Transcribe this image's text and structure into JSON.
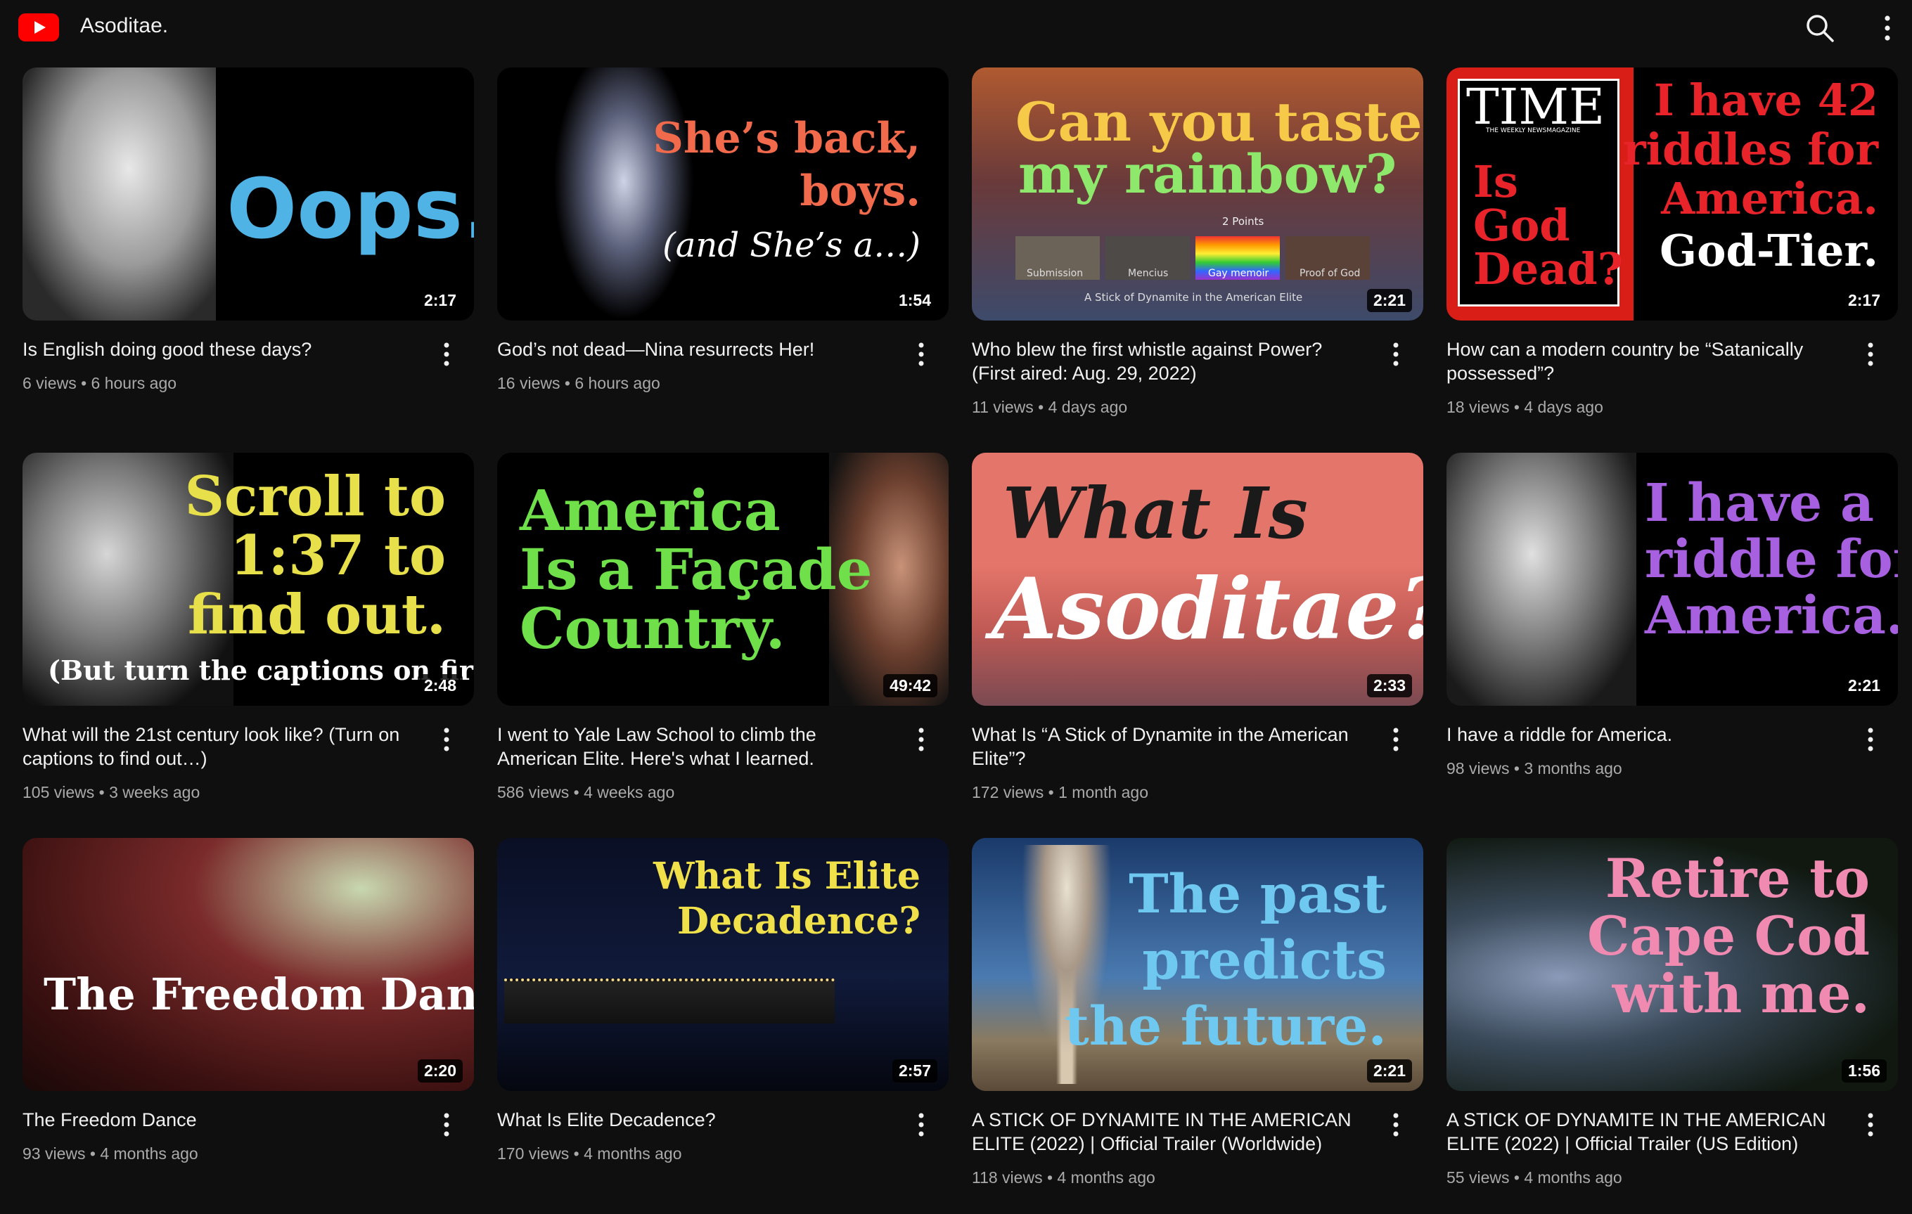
{
  "header": {
    "channel_title": "Asoditae.",
    "logo_icon": "youtube-logo-icon",
    "search_icon": "search-icon",
    "more_icon": "more-vert-icon"
  },
  "colors": {
    "background": "#0f0f0f",
    "text_primary": "#f1f1f1",
    "text_secondary": "#aaaaaa",
    "brand_red": "#ff0000"
  },
  "videos": [
    {
      "title_line1": "Is English doing good these days?",
      "title_line2": "",
      "views": "6 views",
      "age": "6 hours ago",
      "duration": "2:17",
      "thumb_lines": [
        "Oops."
      ]
    },
    {
      "title_line1": "God’s not dead—Nina resurrects Her!",
      "title_line2": "",
      "views": "16 views",
      "age": "6 hours ago",
      "duration": "1:54",
      "thumb_lines": [
        "She’s back,",
        "boys.",
        "(and She’s a…)"
      ]
    },
    {
      "title_line1": "Who blew the first whistle against Power?",
      "title_line2": "(First aired: Aug. 29, 2022)",
      "views": "11 views",
      "age": "4 days ago",
      "duration": "2:21",
      "thumb_lines": [
        "Can you taste",
        "my rainbow?",
        "2 Points",
        "Submission",
        "Mencius",
        "Gay memoir",
        "Proof of God",
        "A Stick of Dynamite in the American Elite"
      ]
    },
    {
      "title_line1": "How can a modern country be “Satanically",
      "title_line2": "possessed”?",
      "views": "18 views",
      "age": "4 days ago",
      "duration": "2:17",
      "thumb_lines": [
        "TIME",
        "THE WEEKLY NEWSMAGAZINE",
        "Is",
        "God",
        "Dead?",
        "I have 42",
        "riddles for",
        "America.",
        "God-Tier."
      ]
    },
    {
      "title_line1": "What will the 21st century look like? (Turn on",
      "title_line2": "captions to find out…)",
      "views": "105 views",
      "age": "3 weeks ago",
      "duration": "2:48",
      "thumb_lines": [
        "Scroll to",
        "1:37 to",
        "find out.",
        "(But turn the captions on first.)"
      ]
    },
    {
      "title_line1": "I went to Yale Law School to climb the",
      "title_line2": "American Elite. Here's what I learned.",
      "views": "586 views",
      "age": "4 weeks ago",
      "duration": "49:42",
      "thumb_lines": [
        "America",
        "Is a Façade",
        "Country."
      ]
    },
    {
      "title_line1": "What Is “A Stick of Dynamite in the American",
      "title_line2": "Elite”?",
      "views": "172 views",
      "age": "1 month ago",
      "duration": "2:33",
      "thumb_lines": [
        "What Is",
        "Asoditae?"
      ]
    },
    {
      "title_line1": "I have a riddle for America.",
      "title_line2": "",
      "views": "98 views",
      "age": "3 months ago",
      "duration": "2:21",
      "thumb_lines": [
        "I have a",
        "riddle for",
        "America."
      ]
    },
    {
      "title_line1": "The Freedom Dance",
      "title_line2": "",
      "views": "93 views",
      "age": "4 months ago",
      "duration": "2:20",
      "thumb_lines": [
        "The Freedom Dance"
      ]
    },
    {
      "title_line1": "What Is Elite Decadence?",
      "title_line2": "",
      "views": "170 views",
      "age": "4 months ago",
      "duration": "2:57",
      "thumb_lines": [
        "What Is Elite",
        "Decadence?"
      ]
    },
    {
      "title_line1": "A STICK OF DYNAMITE IN THE AMERICAN",
      "title_line2": "ELITE (2022) | Official Trailer (Worldwide)",
      "views": "118 views",
      "age": "4 months ago",
      "duration": "2:21",
      "thumb_lines": [
        "The past",
        "predicts",
        "the future."
      ]
    },
    {
      "title_line1": "A STICK OF DYNAMITE IN THE AMERICAN",
      "title_line2": "ELITE (2022) | Official Trailer (US Edition)",
      "views": "55 views",
      "age": "4 months ago",
      "duration": "1:56",
      "thumb_lines": [
        "Retire to",
        "Cape Cod",
        "with me."
      ]
    }
  ]
}
